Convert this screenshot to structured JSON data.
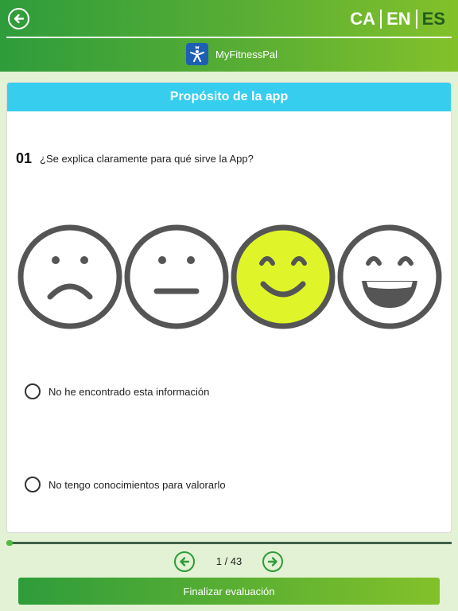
{
  "header": {
    "back_icon": "arrow-left-circle-icon",
    "languages": [
      {
        "code": "CA",
        "active": false
      },
      {
        "code": "EN",
        "active": false
      },
      {
        "code": "ES",
        "active": true
      }
    ],
    "app_icon": "myfitnesspal-logo-icon",
    "app_name": "MyFitnessPal"
  },
  "card": {
    "section_title": "Propósito de la app",
    "question_number": "01",
    "question_text": "¿Se explica claramente para qué sirve la App?",
    "rating_faces": [
      {
        "icon": "sad-face-icon",
        "selected": false
      },
      {
        "icon": "neutral-face-icon",
        "selected": false
      },
      {
        "icon": "smile-face-icon",
        "selected": true,
        "fill": "#dff529"
      },
      {
        "icon": "laughing-face-icon",
        "selected": false
      }
    ],
    "options": [
      {
        "label": "No he encontrado esta información",
        "checked": false
      },
      {
        "label": "No tengo conocimientos para valorarlo",
        "checked": false
      }
    ]
  },
  "progress": {
    "current": 1,
    "total": 43
  },
  "pager": {
    "prev_icon": "arrow-left-circle-icon",
    "next_icon": "arrow-right-circle-icon",
    "label": "1 / 43"
  },
  "footer": {
    "finish_label": "Finalizar evaluación"
  },
  "colors": {
    "header_green": "#2e9c3b",
    "header_lime": "#83c12a",
    "card_title_bg": "#36cdef",
    "selected_face": "#dff529",
    "face_stroke": "#555555",
    "background": "#e3f2d4"
  }
}
